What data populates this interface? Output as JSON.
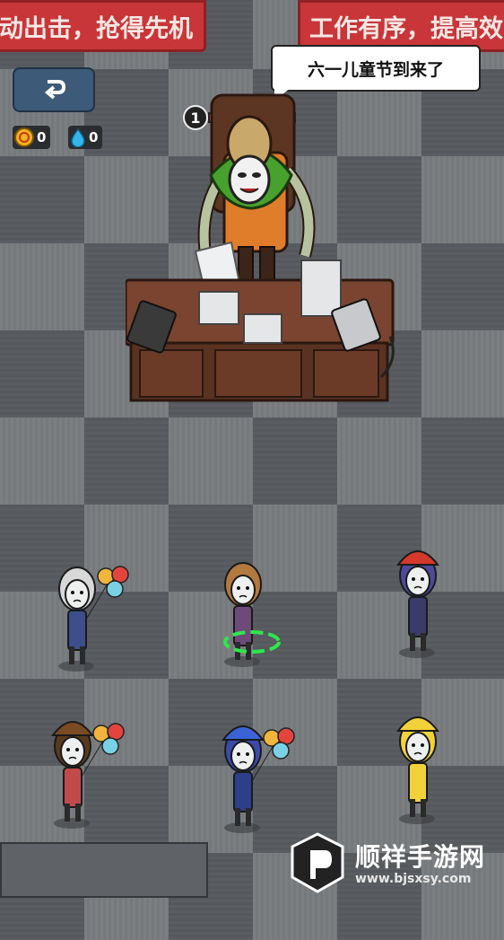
{
  "banners": {
    "left_text": "动出击，抢得先机",
    "right_text": "工作有序，提高效"
  },
  "hud": {
    "back_button_icon": "return-arrow-icon",
    "coins": {
      "icon": "coin-icon",
      "value": "0"
    },
    "water": {
      "icon": "water-drop-icon",
      "value": "0"
    }
  },
  "boss": {
    "level": "1",
    "speech": "六一儿童节到来了",
    "hp_fraction": 1.0
  },
  "characters": [
    {
      "name": "bald-man-with-balloons"
    },
    {
      "name": "girl-with-ponytail"
    },
    {
      "name": "girl-with-firefighter-helmet"
    },
    {
      "name": "girl-with-poop-hat"
    },
    {
      "name": "kid-in-superhero-mask"
    },
    {
      "name": "kid-in-duck-costume"
    }
  ],
  "watermark": {
    "title": "顺祥手游网",
    "url": "www.bjsxsy.com"
  },
  "colors": {
    "banner_red": "#c8363a",
    "floor_dark": "#5a5d61",
    "floor_light": "#7c7f82",
    "select_green": "#2ee84a"
  }
}
